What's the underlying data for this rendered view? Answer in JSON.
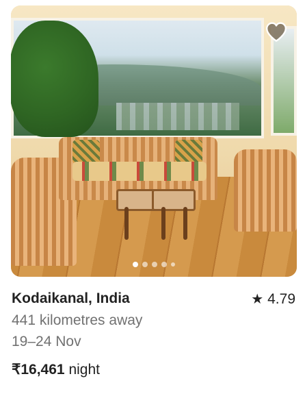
{
  "listing": {
    "location": "Kodaikanal, India",
    "rating": "4.79",
    "distance": "441 kilometres away",
    "dates": "19–24 Nov",
    "price_amount": "₹16,461",
    "price_unit": "night"
  },
  "photo": {
    "dot_count": 5,
    "active_dot": 1,
    "favorite_icon": "heart-icon",
    "rating_icon": "star-icon"
  },
  "colors": {
    "text_primary": "#222222",
    "text_secondary": "#717171",
    "heart_fill": "#7a6d58"
  }
}
